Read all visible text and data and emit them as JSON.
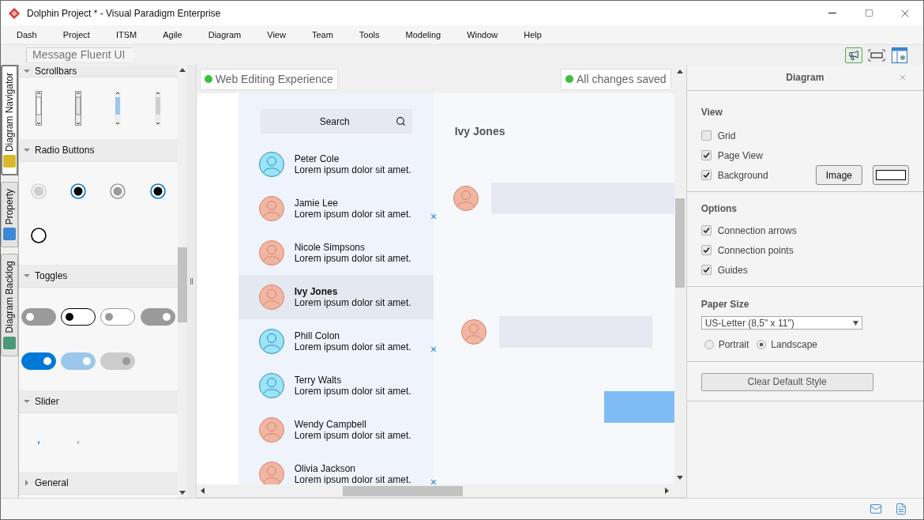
{
  "window": {
    "title": "Dolphin Project * - Visual Paradigm Enterprise"
  },
  "menu": [
    "Dash",
    "Project",
    "ITSM",
    "Agile",
    "Diagram",
    "View",
    "Team",
    "Tools",
    "Modeling",
    "Window",
    "Help"
  ],
  "side_tabs": [
    {
      "label": "Diagram Navigator",
      "selected": true
    },
    {
      "label": "Property",
      "selected": false
    },
    {
      "label": "Diagram Backlog",
      "selected": false
    }
  ],
  "breadcrumb": "Message Fluent UI",
  "palette": [
    {
      "kind": "scrollbars",
      "title": "Scrollbars",
      "expanded": true
    },
    {
      "kind": "radios",
      "title": "Radio Buttons",
      "expanded": true,
      "items": [
        {
          "checked": false,
          "disabled": true
        },
        {
          "checked": true,
          "disabled": false
        },
        {
          "checked": true,
          "disabled": true
        },
        {
          "checked": true,
          "disabled": false
        },
        {
          "checked": false,
          "disabled": false
        }
      ]
    },
    {
      "kind": "toggles",
      "title": "Toggles",
      "expanded": true,
      "items": [
        {
          "kind": "gray",
          "on": false
        },
        {
          "kind": "outline",
          "on": false
        },
        {
          "kind": "outlinedisabled",
          "on": false
        },
        {
          "kind": "gray",
          "on": true
        },
        {
          "kind": "blue",
          "on": true
        },
        {
          "kind": "lightblue",
          "on": true
        },
        {
          "kind": "disabled",
          "on": true
        }
      ]
    },
    {
      "kind": "sliders",
      "title": "Slider",
      "expanded": true
    },
    {
      "kind": "general",
      "title": "General",
      "expanded": false
    }
  ],
  "canvas": {
    "badges": [
      "Web Editing Experience",
      "All changes saved"
    ],
    "search": {
      "placeholder": "Search"
    },
    "contacts": [
      {
        "name": "Peter Cole",
        "message": "Lorem ipsum dolor sit amet.",
        "color": "#9be3f8",
        "selected": false,
        "marked": false
      },
      {
        "name": "Jamie Lee",
        "message": "Lorem ipsum dolor sit amet.",
        "color": "#f0b6a3",
        "selected": false,
        "marked": true
      },
      {
        "name": "Nicole Simpsons",
        "message": "Lorem ipsum dolor sit amet.",
        "color": "#f0b6a3",
        "selected": false,
        "marked": false
      },
      {
        "name": "Ivy Jones",
        "message": "Lorem ipsum dolor sit amet.",
        "color": "#f0b6a3",
        "selected": true,
        "marked": false
      },
      {
        "name": "Phill Colon",
        "message": "Lorem ipsum dolor sit amet.",
        "color": "#9be3f8",
        "selected": false,
        "marked": true
      },
      {
        "name": "Terry Walts",
        "message": "Lorem ipsum dolor sit amet.",
        "color": "#9be3f8",
        "selected": false,
        "marked": false
      },
      {
        "name": "Wendy Campbell",
        "message": "Lorem ipsum dolor sit amet.",
        "color": "#f0b6a3",
        "selected": false,
        "marked": false
      },
      {
        "name": "Olivia Jackson",
        "message": "Lorem ipsum dolor sit amet.",
        "color": "#f0b6a3",
        "selected": false,
        "marked": true
      }
    ],
    "chat_title": "Ivy Jones",
    "messages": [
      {
        "kind": "received"
      },
      {
        "kind": "received"
      },
      {
        "kind": "sent"
      }
    ]
  },
  "properties": {
    "title": "Diagram",
    "view": {
      "title": "View",
      "options": [
        {
          "label": "Grid",
          "checked": false
        },
        {
          "label": "Page View",
          "checked": true
        },
        {
          "label": "Background",
          "checked": true
        }
      ],
      "image_button": "Image"
    },
    "options": {
      "title": "Options",
      "options": [
        {
          "label": "Connection arrows",
          "checked": true
        },
        {
          "label": "Connection points",
          "checked": true
        },
        {
          "label": "Guides",
          "checked": true
        }
      ]
    },
    "paper": {
      "title": "Paper Size",
      "value": "US-Letter (8,5\" x 11\")",
      "orientations": [
        {
          "label": "Portrait",
          "selected": false
        },
        {
          "label": "Landscape",
          "selected": true
        }
      ]
    },
    "clear_button": "Clear Default Style"
  }
}
